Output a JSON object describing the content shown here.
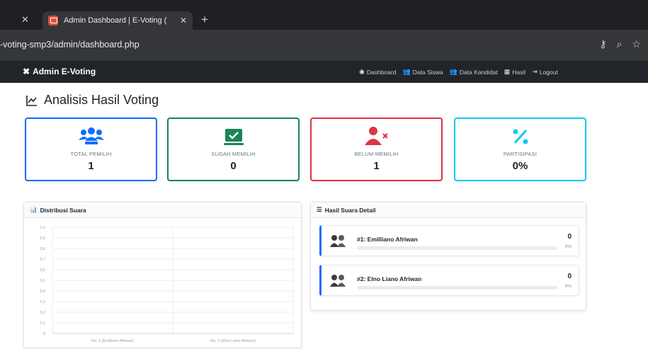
{
  "browser": {
    "tab_title": "Admin Dashboard | E-Voting (",
    "url": "-voting-smp3/admin/dashboard.php"
  },
  "navbar": {
    "brand": "Admin E-Voting",
    "links": [
      {
        "label": "Dashboard",
        "icon": "dashboard-icon"
      },
      {
        "label": "Data Siswa",
        "icon": "users-icon"
      },
      {
        "label": "Data Kandidat",
        "icon": "candidates-icon"
      },
      {
        "label": "Hasil",
        "icon": "results-icon"
      },
      {
        "label": "Logout",
        "icon": "logout-icon"
      }
    ]
  },
  "page": {
    "title": "Analisis Hasil Voting"
  },
  "stats": [
    {
      "label": "TOTAL PEMILIH",
      "value": "1",
      "color": "#0d6efd",
      "icon": "users-icon"
    },
    {
      "label": "SUDAH MEMILIH",
      "value": "0",
      "color": "#198754",
      "icon": "check-box-icon"
    },
    {
      "label": "BELUM MEMILIH",
      "value": "1",
      "color": "#dc3545",
      "icon": "user-x-icon"
    },
    {
      "label": "PARTISIPASI",
      "value": "0%",
      "color": "#0dcaf0",
      "icon": "percent-icon"
    }
  ],
  "distribution": {
    "title": "Distribusi Suara"
  },
  "chart_data": {
    "type": "bar",
    "categories": [
      "No. 1 (Emilliano Afriwan)",
      "No. 3 (Elno Liano Afriwan)"
    ],
    "values": [
      0,
      0
    ],
    "ylim": [
      0,
      1
    ],
    "yticks": [
      "0",
      "0,1",
      "0,2",
      "0,3",
      "0,4",
      "0,5",
      "0,6",
      "0,7",
      "0,8",
      "0,9",
      "1,0"
    ],
    "grid": true,
    "bar_color": "#0d6efd"
  },
  "results": {
    "title": "Hasil Suara Detail",
    "candidates": [
      {
        "name": "#1: Emilliano Afriwan",
        "count": "0",
        "pct_label": "0%",
        "pct": 0
      },
      {
        "name": "#2: Elno Liano Afriwan",
        "count": "0",
        "pct_label": "0%",
        "pct": 0
      }
    ]
  }
}
